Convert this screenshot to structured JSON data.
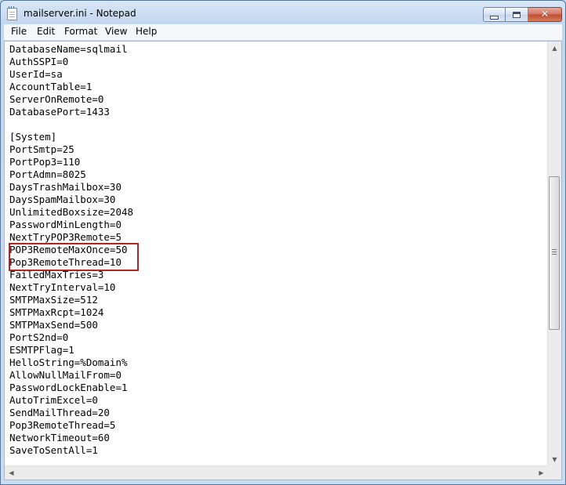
{
  "window": {
    "title": "mailserver.ini - Notepad"
  },
  "menu": [
    "File",
    "Edit",
    "Format",
    "View",
    "Help"
  ],
  "editor": {
    "lines": [
      "DatabaseName=sqlmail",
      "AuthSSPI=0",
      "UserId=sa",
      "AccountTable=1",
      "ServerOnRemote=0",
      "DatabasePort=1433",
      "",
      "[System]",
      "PortSmtp=25",
      "PortPop3=110",
      "PortAdmn=8025",
      "DaysTrashMailbox=30",
      "DaysSpamMailbox=30",
      "UnlimitedBoxsize=2048",
      "PasswordMinLength=0",
      "NextTryPOP3Remote=5",
      "POP3RemoteMaxOnce=50",
      "Pop3RemoteThread=10",
      "FailedMaxTries=3",
      "NextTryInterval=10",
      "SMTPMaxSize=512",
      "SMTPMaxRcpt=1024",
      "SMTPMaxSend=500",
      "PortS2nd=0",
      "ESMTPFlag=1",
      "HelloString=%Domain%",
      "AllowNullMailFrom=0",
      "PasswordLockEnable=1",
      "AutoTrimExcel=0",
      "SendMailThread=20",
      "Pop3RemoteThread=5",
      "NetworkTimeout=60",
      "SaveToSentAll=1"
    ]
  },
  "annotation": {
    "color": "#b32525",
    "highlighted_lines": [
      17,
      18
    ]
  },
  "colors": {
    "title_bar": "#c9dcf1",
    "close_button": "#c04a2e",
    "menu_bar": "#f5f6f7",
    "editor_bg": "#ffffff"
  }
}
